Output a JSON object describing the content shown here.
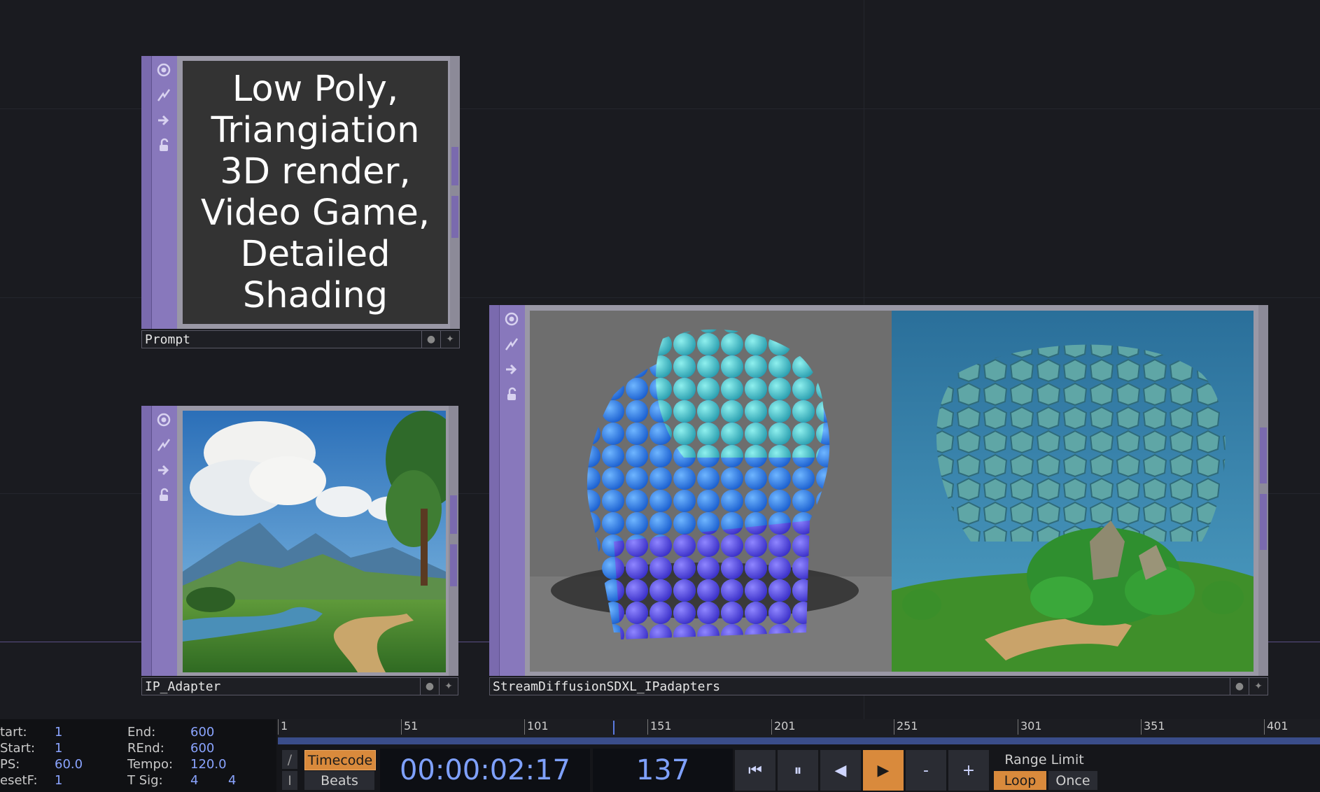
{
  "nodes": {
    "prompt": {
      "name": "Prompt",
      "text_lines": [
        "Low Poly,",
        "Triangiation",
        "3D render,",
        "Video Game,",
        "Detailed",
        "Shading"
      ]
    },
    "ip_adapter": {
      "name": "IP_Adapter"
    },
    "stream": {
      "name": "StreamDiffusionSDXL_IPadapters"
    }
  },
  "node_icons": [
    "viewer-toggle-icon",
    "bypass-icon",
    "export-arrow-icon",
    "lock-icon"
  ],
  "stats": {
    "start_label": "tart:",
    "start_value": "1",
    "rstart_label": "Start:",
    "rstart_value": "1",
    "fps_label": "PS:",
    "fps_value": "60.0",
    "resetf_label": "esetF:",
    "resetf_value": "1",
    "end_label": "End:",
    "end_value": "600",
    "rend_label": "REnd:",
    "rend_value": "600",
    "tempo_label": "Tempo:",
    "tempo_value": "120.0",
    "tsig_label": "T Sig:",
    "tsig_value_a": "4",
    "tsig_value_b": "4"
  },
  "timeline": {
    "ticks": [
      "1",
      "51",
      "101",
      "151",
      "201",
      "251",
      "301",
      "351",
      "401"
    ],
    "current_frame": 137
  },
  "transport": {
    "timecode_label": "Timecode",
    "beats_label": "Beats",
    "timecode": "00:00:02:17",
    "frame": "137",
    "range_limit_label": "Range Limit",
    "loop_label": "Loop",
    "once_label": "Once",
    "minus_label": "-",
    "plus_label": "+",
    "slash_label": "/",
    "bar_label": "I"
  },
  "colors": {
    "node_purple": "#7a6aae",
    "accent_orange": "#d98a3c",
    "timecode_blue": "#7fa1ff"
  }
}
